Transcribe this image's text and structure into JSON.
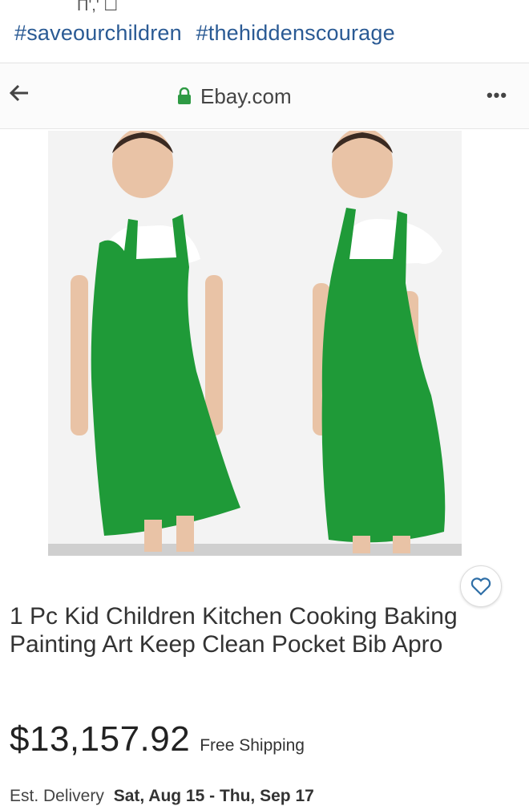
{
  "post": {
    "top_crop_text": "Π',' ☐",
    "hashtags": [
      "#saveourchildren",
      "#thehiddenscourage"
    ]
  },
  "browser": {
    "back_icon": "back-arrow-icon",
    "lock_icon": "lock-icon",
    "url": "Ebay.com",
    "more_icon": "more-dots-icon",
    "more_label": "•••"
  },
  "listing": {
    "favorite_icon": "heart-icon",
    "title": "1 Pc Kid Children Kitchen Cooking Baking Painting Art Keep Clean Pocket Bib Apro",
    "price": "$13,157.92",
    "shipping": "Free Shipping",
    "delivery_label": "Est. Delivery",
    "delivery_dates": "Sat, Aug 15 - Thu, Sep 17",
    "accent_color": "#23a03f"
  }
}
